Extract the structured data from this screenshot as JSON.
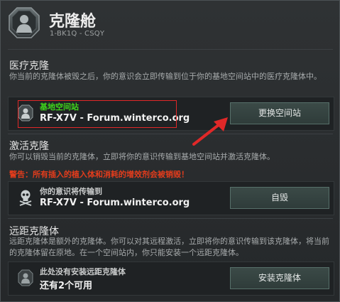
{
  "header": {
    "title": "克隆舱",
    "subtitle": "1-BK1Q - CSQY"
  },
  "medical": {
    "title": "医疗克隆",
    "desc": "你当前的克隆体被毁之后，你的意识会立即传输到位于你的基地空间站中的医疗克隆体中。",
    "line1": "基地空间站",
    "line2": "RF-X7V - Forum.winterco.org",
    "button": "更换空间站"
  },
  "activate": {
    "title": "激活克隆",
    "desc": "你可以销毁当前的克隆体，立即将你的意识传输到基地空间站并激活克隆体。",
    "warning": "警告：所有插入的植入体和消耗的增效剂会被销毁！",
    "line1": "你的意识将传输到",
    "line2": "RF-X7V - Forum.winterco.org",
    "button": "自毁"
  },
  "remote": {
    "title": "远距克隆体",
    "desc": "远距克隆体是额外的克隆体。你可以对其远程激活，立即将你的意识传输到该克隆体，将当前的克隆体留在原地。在一个空间站内，你只能安装一个远距克隆体。",
    "line1": "此处没有安装远距克隆体",
    "line2": "还有2个可用",
    "button": "安装克隆体"
  },
  "colors": {
    "accent_green": "#3fd61b",
    "warning_red": "#e23c1c",
    "annotation_red": "#e02828"
  }
}
